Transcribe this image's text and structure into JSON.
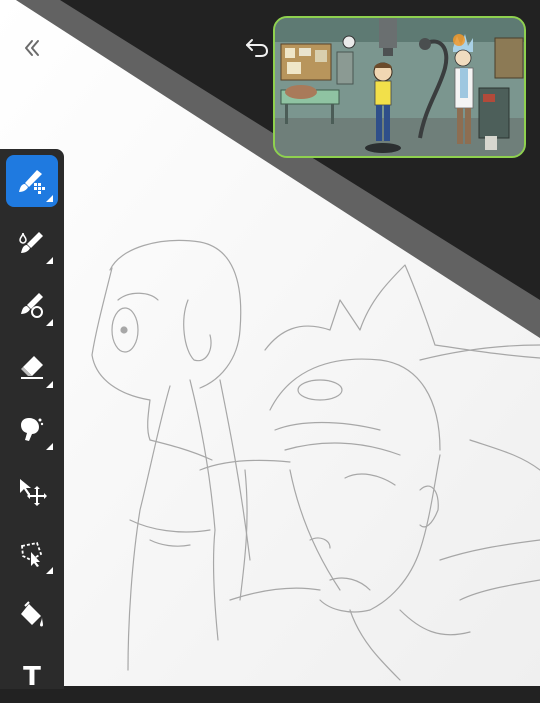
{
  "app": {
    "accent_color": "#1f7ae0",
    "reference_border_color": "#8fd14f",
    "toolbar_color": "#2b2b2b",
    "background_color": "#222222"
  },
  "top_bar": {
    "back_icon": "chevron-double-left-icon",
    "undo_icon": "undo-arrow-icon"
  },
  "reference": {
    "description_icon": "reference-image-thumbnail"
  },
  "toolbar": {
    "tools": [
      {
        "icon": "brush-grid-icon",
        "active": true
      },
      {
        "icon": "paint-brush-icon",
        "active": false
      },
      {
        "icon": "blend-brush-icon",
        "active": false
      },
      {
        "icon": "eraser-icon",
        "active": false
      },
      {
        "icon": "smudge-icon",
        "active": false
      },
      {
        "icon": "move-transform-icon",
        "active": false
      },
      {
        "icon": "lasso-select-icon",
        "active": false
      },
      {
        "icon": "paint-bucket-icon",
        "active": false
      },
      {
        "icon": "text-tool-icon",
        "active": false
      }
    ],
    "text_tool_label": "T"
  }
}
